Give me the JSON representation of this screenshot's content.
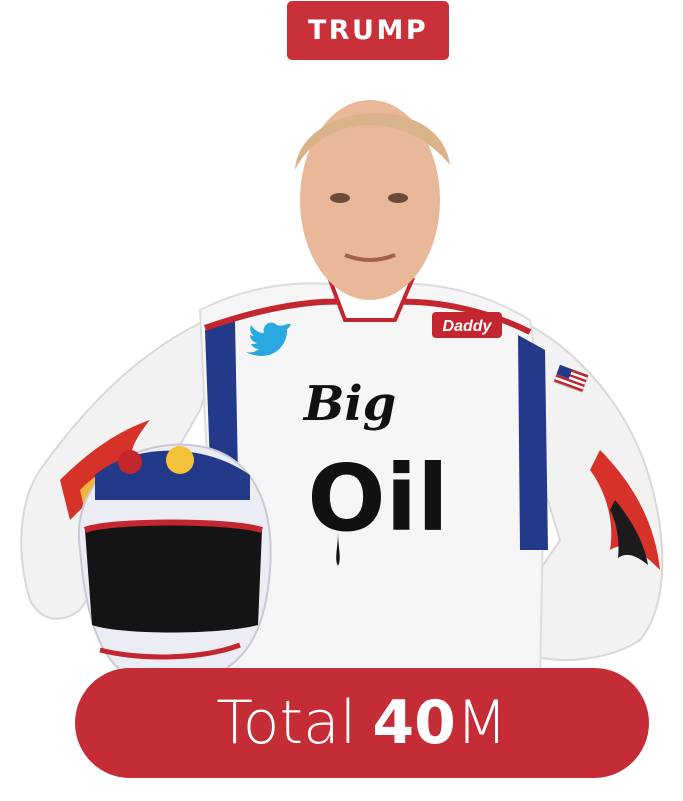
{
  "badge": {
    "name": "TRUMP",
    "color": "#c8303a"
  },
  "figure": {
    "chest_logo_line1": "Big",
    "chest_logo_line2": "Oil",
    "patch_text": "Daddy",
    "icons": [
      "twitter-bird-icon",
      "us-flag-icon",
      "racing-helmet",
      "flame-decal"
    ]
  },
  "total": {
    "label": "Total",
    "value": "40",
    "unit": "M",
    "color": "#c52d36"
  }
}
